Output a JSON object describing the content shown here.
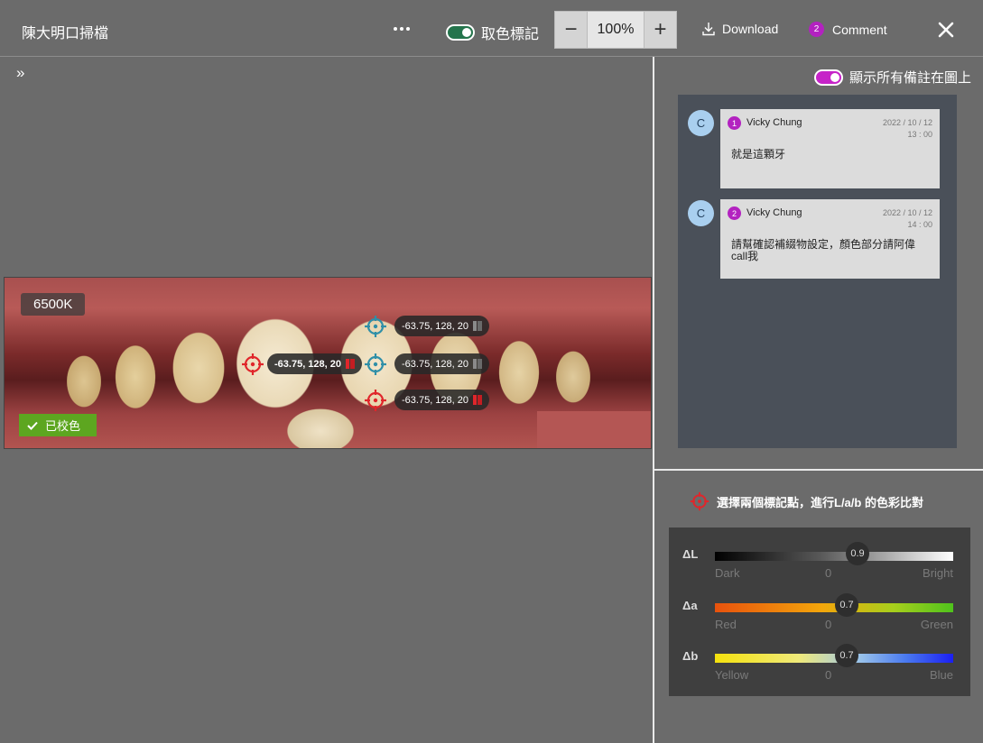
{
  "header": {
    "title": "陳大明口掃檔",
    "more_icon": "more-horizontal-icon",
    "color_mark_label": "取色標記",
    "color_mark_enabled": true,
    "zoom": {
      "minus": "−",
      "value": "100%",
      "plus": "+"
    },
    "download_label": "Download",
    "comment_label": "Comment",
    "comment_count": "2",
    "close_icon": "close-icon"
  },
  "viewer": {
    "expand_label": "»",
    "color_temperature": "6500K",
    "calibrated_label": "已校色",
    "swatch_color": "#b45654",
    "markers": [
      {
        "type": "blue",
        "label": "-63.75, 128, 20"
      },
      {
        "type": "red",
        "label": "-63.75, 128, 20"
      },
      {
        "type": "blue",
        "label": "-63.75, 128, 20"
      },
      {
        "type": "red",
        "label": "-63.75, 128, 20"
      }
    ]
  },
  "sidebar": {
    "show_all_label": "顯示所有備註在圖上",
    "show_all_enabled": true,
    "comments": [
      {
        "number": "1",
        "avatar": "C",
        "author": "Vicky Chung",
        "date": "2022 / 10 / 12",
        "time": "13 : 00",
        "text": "就是這顆牙"
      },
      {
        "number": "2",
        "avatar": "C",
        "author": "Vicky Chung",
        "date": "2022 / 10 / 12",
        "time": "14 : 00",
        "text": "請幫確認補綴物設定，顏色部分請阿偉call我"
      }
    ],
    "compare_title": "選擇兩個標記點，進行L/a/b 的色彩比對",
    "lab": [
      {
        "name": "ΔL",
        "value": "0.9",
        "left": "Dark",
        "mid": "0",
        "right": "Bright"
      },
      {
        "name": "Δa",
        "value": "0.7",
        "left": "Red",
        "mid": "0",
        "right": "Green"
      },
      {
        "name": "Δb",
        "value": "0.7",
        "left": "Yellow",
        "mid": "0",
        "right": "Blue"
      }
    ]
  },
  "colors": {
    "accent_purple": "#b322c0",
    "toggle_green": "#24744c",
    "marker_red": "#e0262b",
    "marker_blue": "#2f8fa8",
    "calibrated_green": "#5da620"
  }
}
